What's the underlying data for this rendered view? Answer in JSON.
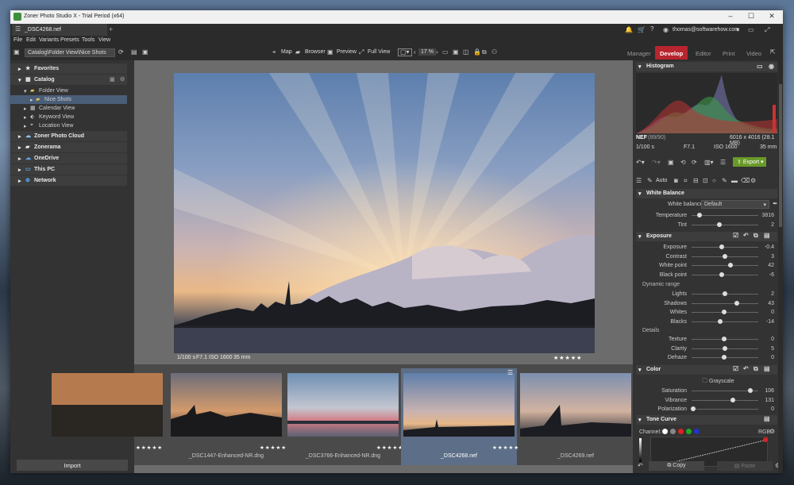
{
  "window": {
    "title": "Zoner Photo Studio X - Trial Period (x64)",
    "controls": [
      "–",
      "☐",
      "✕"
    ]
  },
  "tab": {
    "name": "_DSC4268.nef",
    "add": "+"
  },
  "account": {
    "email": "thomas@softwarehow.com"
  },
  "menu": [
    "File",
    "Edit",
    "Variants",
    "Presets",
    "Tools",
    "View"
  ],
  "toolbar": {
    "path": "Catalog\\Folder View\\Nice Shots",
    "map": "Map",
    "browser": "Browser",
    "preview": "Preview",
    "full_view": "Full View",
    "zoom": "17 %"
  },
  "modules": [
    {
      "name": "Manager",
      "active": false
    },
    {
      "name": "Develop",
      "active": true
    },
    {
      "name": "Editor",
      "active": false
    },
    {
      "name": "Print",
      "active": false
    },
    {
      "name": "Video",
      "active": false
    }
  ],
  "navigator": {
    "favorites": "Favorites",
    "catalog": "Catalog",
    "folder_view": "Folder View",
    "nice_shots": "Nice Shots",
    "calendar_view": "Calendar View",
    "keyword_view": "Keyword View",
    "location_view": "Location View",
    "zoner_photo_cloud": "Zoner Photo Cloud",
    "zonerama": "Zonerama",
    "onedrive": "OneDrive",
    "this_pc": "This PC",
    "network": "Network",
    "import": "Import"
  },
  "photo_meta": {
    "shutter": "1/100 s",
    "aperture": "F7.1",
    "iso": "ISO 1600",
    "focal": "35 mm",
    "rating": "★★★★★"
  },
  "filmstrip": [
    {
      "name": "",
      "stars": "★★★★★"
    },
    {
      "name": "_DSC1447-Enhanced-NR.dng",
      "stars": "★★★★★"
    },
    {
      "name": "_DSC3766-Enhanced-NR.dng",
      "stars": "★★★★★"
    },
    {
      "name": "_DSC4268.nef",
      "stars": "★★★★★",
      "selected": true
    },
    {
      "name": "_DSC4269.nef",
      "stars": "★★★★★"
    }
  ],
  "histogram": {
    "title": "Histogram",
    "format": "NEF",
    "count": "(89/90)",
    "dims": "6016 x 4016 (28.1 MB)",
    "shutter": "1/100 s",
    "aperture": "F7.1",
    "iso": "ISO 1600",
    "focal": "35 mm"
  },
  "actions": {
    "export": "Export",
    "auto": "Auto",
    "copy": "Copy",
    "paste": "Paste"
  },
  "white_balance": {
    "title": "White Balance",
    "label": "White balance",
    "preset": "Default"
  },
  "wb_sliders": [
    {
      "label": "Temperature",
      "value": "3816",
      "pos": 0.12
    },
    {
      "label": "Tint",
      "value": "2",
      "pos": 0.42
    }
  ],
  "exposure": {
    "title": "Exposure",
    "dynamic_range": "Dynamic range",
    "details": "Details"
  },
  "exposure_sliders": [
    {
      "label": "Exposure",
      "value": "-0.4",
      "pos": 0.45
    },
    {
      "label": "Contrast",
      "value": "3",
      "pos": 0.5
    },
    {
      "label": "White point",
      "value": "42",
      "pos": 0.58
    },
    {
      "label": "Black point",
      "value": "-6",
      "pos": 0.45
    }
  ],
  "dynamic_sliders": [
    {
      "label": "Lights",
      "value": "2",
      "pos": 0.5
    },
    {
      "label": "Shadows",
      "value": "43",
      "pos": 0.68
    },
    {
      "label": "Whites",
      "value": "0",
      "pos": 0.49
    },
    {
      "label": "Blacks",
      "value": "-14",
      "pos": 0.43
    }
  ],
  "detail_sliders": [
    {
      "label": "Texture",
      "value": "0",
      "pos": 0.49
    },
    {
      "label": "Clarity",
      "value": "5",
      "pos": 0.5
    },
    {
      "label": "Dehaze",
      "value": "0",
      "pos": 0.49
    }
  ],
  "color": {
    "title": "Color",
    "grayscale": "Grayscale"
  },
  "color_sliders": [
    {
      "label": "Saturation",
      "value": "106",
      "pos": 0.88
    },
    {
      "label": "Vibrance",
      "value": "131",
      "pos": 0.62
    },
    {
      "label": "Polarization",
      "value": "0",
      "pos": 0.02
    }
  ],
  "tone_curve": {
    "title": "Tone Curve",
    "channel": "Channel:",
    "mode": "RGB"
  },
  "colors": {
    "accent": "#b8252e",
    "export": "#6a9a2a",
    "selection": "#4a5e78"
  }
}
